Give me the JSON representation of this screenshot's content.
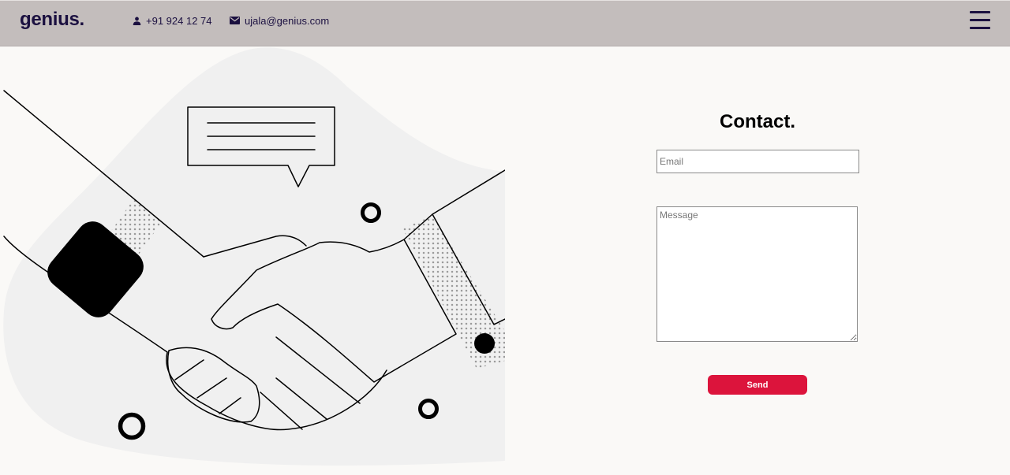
{
  "navbar": {
    "brand": "genius.",
    "phone": "+91 924 12 74",
    "email": "ujala@genius.com",
    "icons": {
      "phone": "person-icon",
      "email": "envelope-icon",
      "menu": "hamburger-menu-icon"
    }
  },
  "contact_form": {
    "title": "Contact.",
    "email_placeholder": "Email",
    "email_value": "",
    "message_placeholder": "Message",
    "message_value": "",
    "send_label": "Send"
  },
  "colors": {
    "navbar_bg": "#c3bdbc",
    "brand_text": "#1b1040",
    "page_bg": "#faf9f7",
    "send_button": "#dc143c",
    "illustration_blob": "#f0f0f0"
  }
}
